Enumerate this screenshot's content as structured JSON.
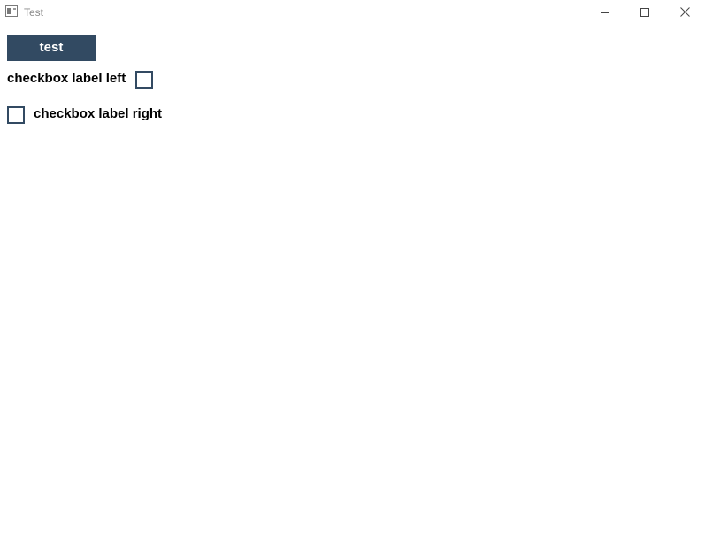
{
  "window": {
    "title": "Test",
    "controls": {
      "minimize": "minimize-icon",
      "maximize": "maximize-icon",
      "close": "close-icon"
    }
  },
  "main": {
    "button_label": "test",
    "checkbox_left": {
      "label": "checkbox label left",
      "checked": false
    },
    "checkbox_right": {
      "label": "checkbox label right",
      "checked": false
    }
  },
  "colors": {
    "accent": "#324a62",
    "title_text": "#8a8a8a",
    "background": "#ffffff"
  }
}
